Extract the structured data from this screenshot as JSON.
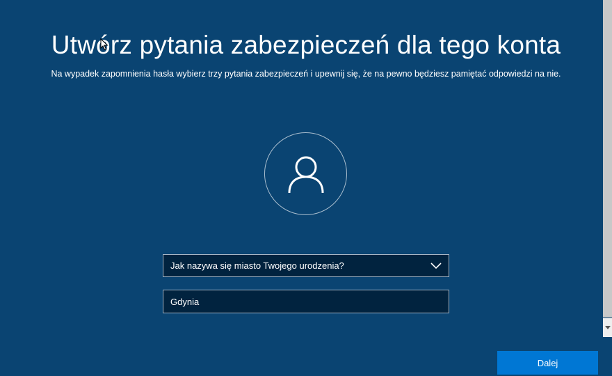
{
  "page": {
    "title": "Utwórz pytania zabezpieczeń dla tego konta",
    "subtitle": "Na wypadek zapomnienia hasła wybierz trzy pytania zabezpieczeń i upewnij się, że na pewno będziesz pamiętać odpowiedzi na nie."
  },
  "form": {
    "question_selected": "Jak nazywa się miasto Twojego urodzenia?",
    "answer_value": "Gdynia"
  },
  "footer": {
    "next_label": "Dalej"
  },
  "icons": {
    "avatar": "user-icon",
    "dropdown": "chevron-down-icon",
    "cursor": "mouse-pointer-icon"
  },
  "colors": {
    "background": "#0a4472",
    "field_background": "#01233f",
    "accent": "#0077d4"
  }
}
